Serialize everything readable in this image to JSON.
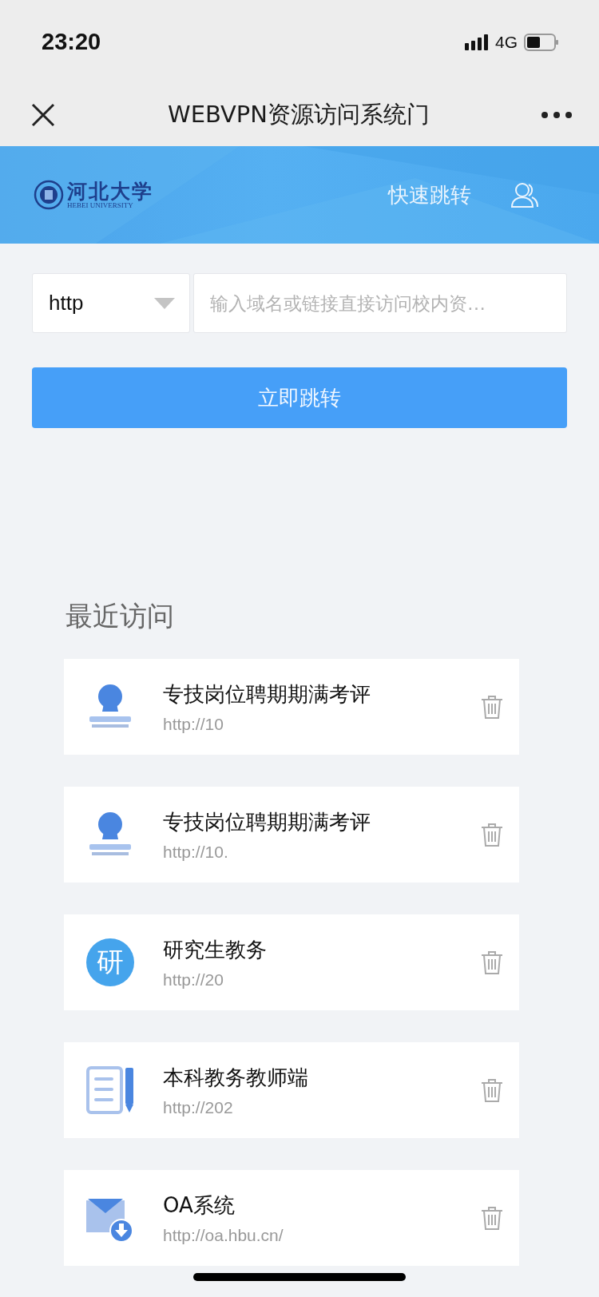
{
  "status_bar": {
    "time": "23:20",
    "network": "4G"
  },
  "nav_bar": {
    "title": "WEBVPN资源访问系统门"
  },
  "header": {
    "logo_name": "河北大学",
    "logo_subtitle": "HEBEI UNIVERSITY",
    "quick_jump": "快速跳转"
  },
  "form": {
    "protocol": "http",
    "placeholder": "输入域名或链接直接访问校内资…",
    "submit": "立即跳转"
  },
  "recent": {
    "title": "最近访问",
    "items": [
      {
        "kind": "stamp",
        "name": "专技岗位聘期期满考评",
        "url": "http://10"
      },
      {
        "kind": "stamp",
        "name": "专技岗位聘期期满考评",
        "url": "http://10."
      },
      {
        "kind": "char",
        "icon_text": "研",
        "name": "研究生教务",
        "url": "http://20"
      },
      {
        "kind": "document",
        "name": "本科教务教师端",
        "url": "http://202"
      },
      {
        "kind": "mail",
        "name": "OA系统",
        "url": "http://oa.hbu.cn/"
      }
    ]
  }
}
